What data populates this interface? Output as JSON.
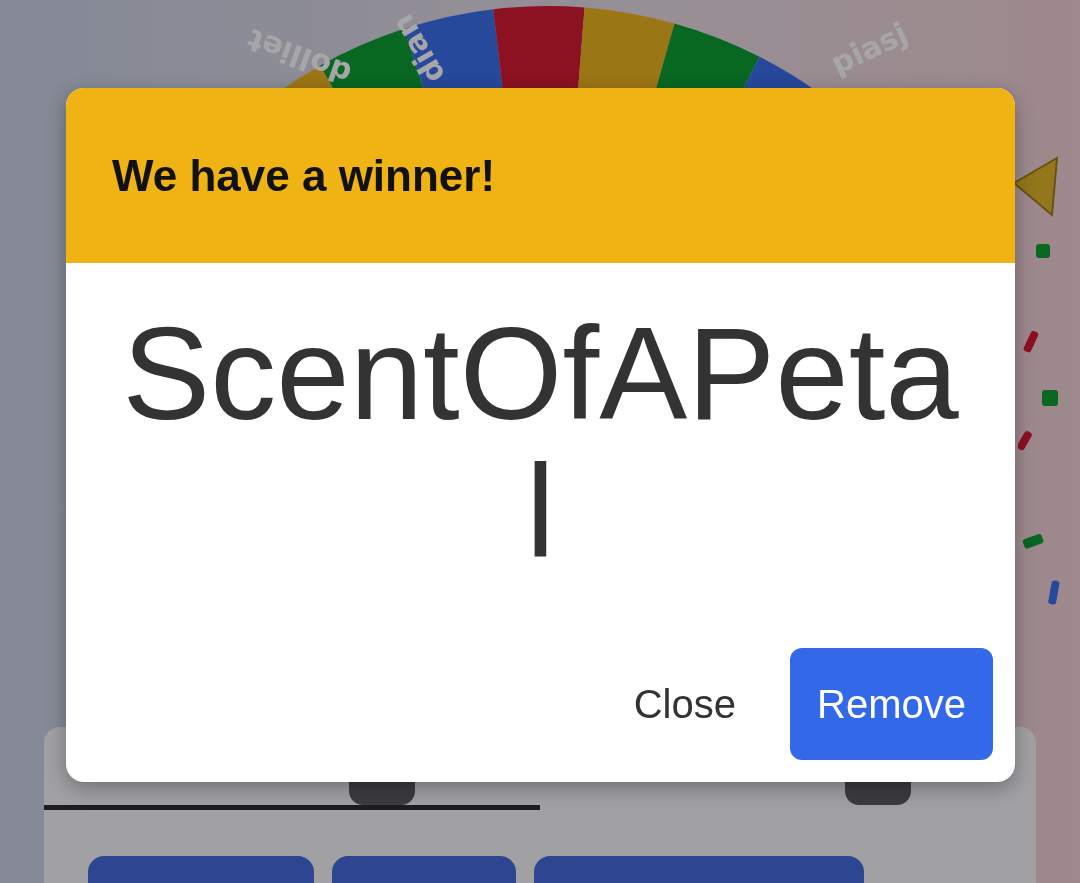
{
  "wheel": {
    "labels": [
      {
        "text": "dolliet"
      },
      {
        "text": "dian"
      },
      {
        "text": "piasj"
      }
    ]
  },
  "panel": {
    "tabs": [
      {
        "selected": true
      },
      {
        "selected": false
      }
    ]
  },
  "dialog": {
    "title": "We have a winner!",
    "winner": "ScentOfAPetal",
    "buttons": [
      {
        "label": "Close",
        "kind": "text"
      },
      {
        "label": "Remove",
        "kind": "primary"
      }
    ]
  }
}
